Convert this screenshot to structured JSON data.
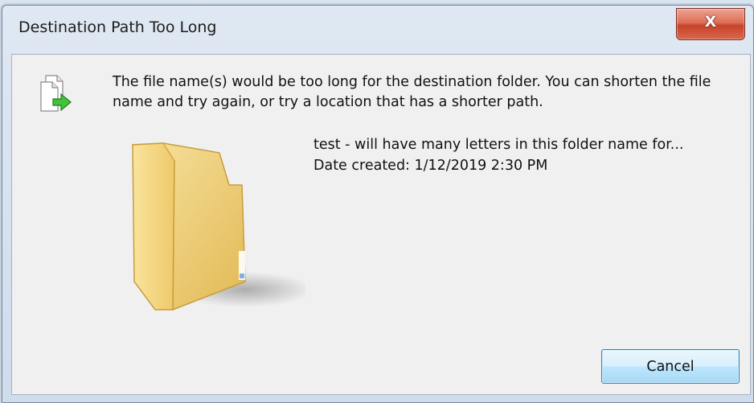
{
  "window": {
    "title": "Destination Path Too Long",
    "close_label": "X"
  },
  "dialog": {
    "message": "The file name(s) would be too long for the destination folder.  You can shorten the file name and try again, or try a location that has a shorter path.",
    "item": {
      "name": "test - will have many letters in this folder name for...",
      "date_created": "Date created: 1/12/2019 2:30 PM",
      "icon": "folder-icon"
    },
    "message_icon": "file-move-icon",
    "cancel_label": "Cancel"
  },
  "colors": {
    "close_button": "#c8432a",
    "button_accent": "#3c7fb1",
    "folder": "#f4d27a"
  }
}
